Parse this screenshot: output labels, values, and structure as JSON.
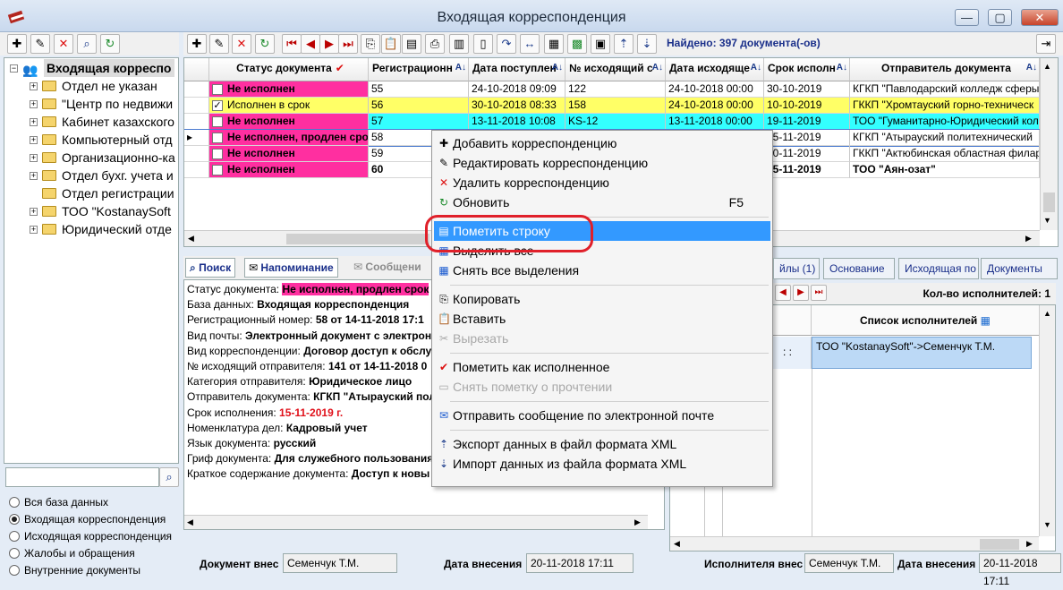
{
  "window": {
    "title": "Входящая корреспонденция"
  },
  "toolbar": {
    "found": "Найдено: 397 документа(-ов)"
  },
  "tree": {
    "root": "Входящая корреспо",
    "items": [
      "Отдел не указан",
      "\"Центр по недвижи",
      "Кабинет казахского",
      "Компьютерный отд",
      "Организационно-ка",
      "Отдел бухг. учета и",
      "Отдел регистрации",
      "ТОО \"KostanaySoft",
      "Юридический отде"
    ]
  },
  "grid": {
    "headers": [
      "Статус документа",
      "Регистрационн",
      "Дата поступлен",
      "№ исходящий с",
      "Дата исходяще",
      "Срок исполн",
      "Отправитель документа"
    ],
    "rows": [
      {
        "status": "Не исполнен",
        "reg": "55",
        "in_date": "24-10-2018 09:09",
        "out_no": "122",
        "out_date": "24-10-2018 00:00",
        "due": "30-10-2019",
        "sender": "КГКП \"Павлодарский колледж сферы"
      },
      {
        "status": "Исполнен в срок",
        "reg": "56",
        "in_date": "30-10-2018 08:33",
        "out_no": "158",
        "out_date": "24-10-2018 00:00",
        "due": "10-10-2019",
        "sender": "ГККП \"Хромтауский горно-техническ"
      },
      {
        "status": "Не исполнен",
        "reg": "57",
        "in_date": "13-11-2018 10:08",
        "out_no": "KS-12",
        "out_date": "13-11-2018 00:00",
        "due": "19-11-2019",
        "sender": "ТОО \"Гуманитарно-Юридический кол"
      },
      {
        "status": "Не исполнен, продлен срок",
        "reg": "58",
        "in_date": "",
        "out_no": "",
        "out_date": "",
        "due": "15-11-2019",
        "sender": "КГКП \"Атырауский политехнический"
      },
      {
        "status": "Не исполнен",
        "reg": "59",
        "in_date": "",
        "out_no": "",
        "out_date": "",
        "due": "20-11-2019",
        "sender": "ГККП \"Актюбинская областная филар"
      },
      {
        "status": "Не исполнен",
        "reg": "60",
        "in_date": "",
        "out_no": "",
        "out_date": "",
        "due": "15-11-2019",
        "sender": "ТОО \"Аян-озат\""
      }
    ]
  },
  "context_menu": {
    "add": "Добавить корреспонденцию",
    "edit": "Редактировать корреспонденцию",
    "delete": "Удалить корреспонденцию",
    "refresh": "Обновить",
    "refresh_key": "F5",
    "mark_row": "Пометить строку",
    "select_all": "Выделить все",
    "clear_all": "Снять все выделения",
    "copy": "Копировать",
    "paste": "Вставить",
    "cut": "Вырезать",
    "mark_done": "Пометить как исполненное",
    "unmark_read": "Снять пометку о прочтении",
    "send_email": "Отправить сообщение по электронной почте",
    "export_xml": "Экспорт данных в файл формата XML",
    "import_xml": "Импорт данных из файла формата XML"
  },
  "bottom_tabs": {
    "search": "Поиск",
    "reminder": "Напоминание",
    "messages": "Сообщени"
  },
  "right_tabs": [
    "йлы (1)",
    "Основание",
    "Исходящая по",
    "Документы"
  ],
  "detail": {
    "status_label": "Статус документа:",
    "status": "Не исполнен, продлен срок",
    "db_label": "База данных:",
    "db": "Входящая корреспонденция",
    "reg_label": "Регистрационный номер:",
    "reg": "58 от 14-11-2018 17:1",
    "mail_label": "Вид почты:",
    "mail": "Электронный документ с электрон",
    "type_label": "Вид корреспонденции:",
    "type": "Договор доступ к обслу",
    "out_label": "№ исходящий отправителя:",
    "out": "141 от 14-11-2018 0",
    "cat_label": "Категория отправителя:",
    "cat": "Юридическое лицо",
    "sender_label": "Отправитель документа:",
    "sender": "КГКП \"Атырауский пол",
    "due_label": "Срок исполнения:",
    "due": "15-11-2019 г.",
    "nom_label": "Номенклатура дел:",
    "nom": "Кадровый учет",
    "lang_label": "Язык документа:",
    "lang": "русский",
    "grif_label": "Гриф документа:",
    "grif": "Для служебного пользования",
    "summary_label": "Краткое содержание документа:",
    "summary": "Доступ к новы"
  },
  "executors": {
    "count": "Кол-во исполнителей: 1",
    "col_date_1": "ата",
    "col_date_2": "лнения",
    "col_list": "Список исполнителей",
    "row_date": ": :",
    "row": "ТОО \"KostanaySoft\"->Семенчук Т.М."
  },
  "radio_options": [
    "Вся база данных",
    "Входящая корреспонденция",
    "Исходящая корреспонденция",
    "Жалобы и обращения",
    "Внутренние документы"
  ],
  "footer": {
    "doc_by_label": "Документ внес",
    "doc_by": "Семенчук Т.М.",
    "date_label": "Дата внесения",
    "date": "20-11-2018 17:11",
    "exec_by_label": "Исполнителя внес",
    "exec_by": "Семенчук Т.М.",
    "exec_date_label": "Дата внесения",
    "exec_date": "20-11-2018 17:11"
  },
  "colors": {
    "pink": "#ff2fa0",
    "yellow": "#ffff66",
    "cyan": "#33ffff",
    "highlight": "#3399ff"
  }
}
